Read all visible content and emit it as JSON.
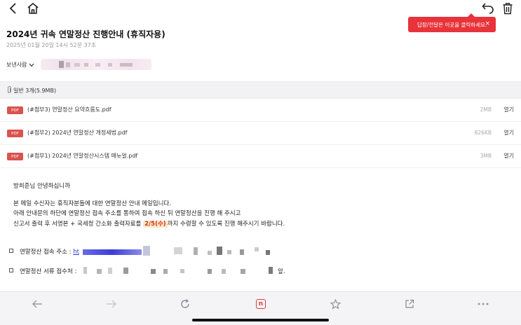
{
  "toolbar": {
    "back_icon": "chevron-left-icon",
    "home_icon": "home-icon",
    "undo_icon": "undo-icon",
    "trash_icon": "trash-icon"
  },
  "tooltip": {
    "text": "답장/전달은 이곳을 클릭하세요.",
    "close": "×"
  },
  "mail": {
    "title": "2024년 귀속 연말정산 진행안내 (휴직자용)",
    "date": "2025년 01월 20일 14시 52분 37초",
    "sender_label": "보낸사람"
  },
  "attachments": {
    "header": "일반 3개(5.9MB)",
    "items": [
      {
        "badge": "PDF",
        "name": "(#첨부3) 연말정산 요약흐름도.pdf",
        "size": "2MB",
        "action": "열기"
      },
      {
        "badge": "PDF",
        "name": "(#첨부2) 2024년 연말정산 개정세법.pdf",
        "size": "826KB",
        "action": "열기"
      },
      {
        "badge": "PDF",
        "name": "(#첨부1) 2024년 연말정산시스템 매뉴얼.pdf",
        "size": "3MB",
        "action": "열기"
      }
    ]
  },
  "body": {
    "greeting": "방희준님 안녕하십니까",
    "line1": "본 메일 수신자는 휴직자분들에 대한 연말정산 안내 메일입니다.",
    "line2": "아래 안내문의 하단에 연말정산 접속 주소를 통하여 접속 하신 뒤 연말정산을 진행 해 주시고",
    "line3_pre": "신고서 출력 후 서명본 + 국세청 간소화 출력자료를 ",
    "line3_highlight": "2/5(수)",
    "line3_post": "까지 수령할 수 있도록 진행 해주시기 바랍니다.",
    "item1_label": "연말정산 접속 주소 :",
    "item1_value_start": "ht",
    "item2_label": "연말정산 서류 접수처 :",
    "item2_value_end": "앞."
  },
  "bottom_nav": {
    "icons": [
      "arrow-left-icon",
      "arrow-right-icon",
      "refresh-icon",
      "naver-icon",
      "star-icon",
      "share-icon",
      "more-icon"
    ],
    "naver_letter": "n"
  }
}
